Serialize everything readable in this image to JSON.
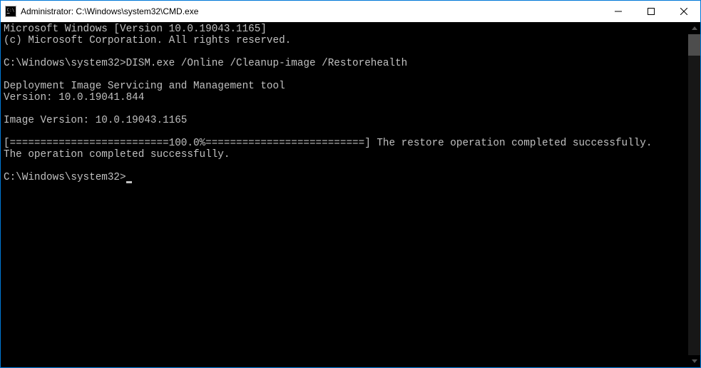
{
  "window": {
    "title": "Administrator: C:\\Windows\\system32\\CMD.exe"
  },
  "terminal": {
    "line1": "Microsoft Windows [Version 10.0.19043.1165]",
    "line2": "(c) Microsoft Corporation. All rights reserved.",
    "line3_prompt": "C:\\Windows\\system32>",
    "line3_cmd": "DISM.exe /Online /Cleanup-image /Restorehealth",
    "line4": "Deployment Image Servicing and Management tool",
    "line5": "Version: 10.0.19041.844",
    "line6": "Image Version: 10.0.19043.1165",
    "line7": "[==========================100.0%==========================] The restore operation completed successfully.",
    "line8": "The operation completed successfully.",
    "line9_prompt": "C:\\Windows\\system32>"
  }
}
